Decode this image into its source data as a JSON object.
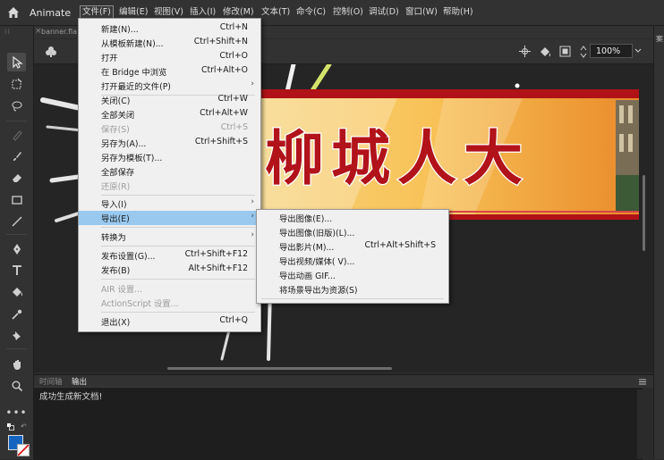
{
  "app": {
    "name": "Animate"
  },
  "menubar": [
    {
      "key": "file",
      "label": "文件(F)"
    },
    {
      "key": "edit",
      "label": "编辑(E)"
    },
    {
      "key": "view",
      "label": "视图(V)"
    },
    {
      "key": "insert",
      "label": "插入(I)"
    },
    {
      "key": "modify",
      "label": "修改(M)"
    },
    {
      "key": "text",
      "label": "文本(T)"
    },
    {
      "key": "commands",
      "label": "命令(C)"
    },
    {
      "key": "control",
      "label": "控制(O)"
    },
    {
      "key": "debug",
      "label": "调试(D)"
    },
    {
      "key": "window",
      "label": "窗口(W)"
    },
    {
      "key": "help",
      "label": "帮助(H)"
    }
  ],
  "document": {
    "tab": "banner.fla",
    "zoom": "100%"
  },
  "right_panel": {
    "label": "案"
  },
  "banner": {
    "text": "柳城人大"
  },
  "file_menu": [
    {
      "label": "新建(N)...",
      "shortcut": "Ctrl+N"
    },
    {
      "label": "从模板新建(N)...",
      "shortcut": "Ctrl+Shift+N"
    },
    {
      "label": "打开",
      "shortcut": "Ctrl+O"
    },
    {
      "label": "在 Bridge 中浏览",
      "shortcut": "Ctrl+Alt+O"
    },
    {
      "label": "打开最近的文件(P)",
      "shortcut": "",
      "submenu": true
    },
    {
      "sep": true
    },
    {
      "label": "关闭(C)",
      "shortcut": "Ctrl+W"
    },
    {
      "label": "全部关闭",
      "shortcut": "Ctrl+Alt+W"
    },
    {
      "label": "保存(S)",
      "shortcut": "Ctrl+S",
      "disabled": true
    },
    {
      "label": "另存为(A)...",
      "shortcut": "Ctrl+Shift+S"
    },
    {
      "label": "另存为模板(T)...",
      "shortcut": ""
    },
    {
      "label": "全部保存",
      "shortcut": ""
    },
    {
      "label": "还原(R)",
      "shortcut": "",
      "disabled": true
    },
    {
      "sep": true
    },
    {
      "label": "导入(I)",
      "shortcut": "",
      "submenu": true
    },
    {
      "label": "导出(E)",
      "shortcut": "",
      "submenu": true,
      "highlighted": true
    },
    {
      "sep": true
    },
    {
      "label": "转换为",
      "shortcut": "",
      "submenu": true
    },
    {
      "sep": true
    },
    {
      "label": "发布设置(G)...",
      "shortcut": "Ctrl+Shift+F12"
    },
    {
      "label": "发布(B)",
      "shortcut": "Alt+Shift+F12"
    },
    {
      "sep": true
    },
    {
      "label": "AIR 设置...",
      "shortcut": "",
      "disabled": true
    },
    {
      "label": "ActionScript 设置...",
      "shortcut": "",
      "disabled": true
    },
    {
      "sep": true
    },
    {
      "label": "退出(X)",
      "shortcut": "Ctrl+Q"
    }
  ],
  "export_submenu": [
    {
      "label": "导出图像(E)...",
      "shortcut": ""
    },
    {
      "label": "导出图像(旧版)(L)...",
      "shortcut": ""
    },
    {
      "label": "导出影片(M)...",
      "shortcut": "Ctrl+Alt+Shift+S"
    },
    {
      "label": "导出视频/媒体( V)...",
      "shortcut": ""
    },
    {
      "label": "导出动画 GIF...",
      "shortcut": ""
    },
    {
      "label": "将场景导出为资源(S)",
      "shortcut": ""
    }
  ],
  "bottom_panel": {
    "tabs": [
      {
        "label": "时间轴",
        "active": false
      },
      {
        "label": "输出",
        "active": true
      }
    ],
    "output_text": "成功生成新文档!"
  },
  "tools": [
    {
      "icon": "selection-tool-icon",
      "selected": true
    },
    {
      "icon": "free-transform-icon"
    },
    {
      "icon": "lasso-icon"
    },
    {
      "icon": "pen-disabled-icon"
    },
    {
      "icon": "brush-icon"
    },
    {
      "icon": "eraser-icon"
    },
    {
      "icon": "rectangle-icon"
    },
    {
      "icon": "line-icon"
    },
    {
      "icon": "pen-tool-icon"
    },
    {
      "icon": "text-tool-icon"
    },
    {
      "icon": "paint-bucket-icon"
    },
    {
      "icon": "eyedropper-icon"
    },
    {
      "icon": "pin-tool-icon"
    },
    {
      "icon": "hand-tool-icon"
    },
    {
      "icon": "zoom-tool-icon"
    },
    {
      "icon": "more-tools-icon"
    }
  ],
  "colors": {
    "menu_bg": "#f0f0f0",
    "menu_highlight": "#99c9ef",
    "fill_color": "#1565c0",
    "banner_red": "#b01217",
    "banner_gold": "#f3b54a"
  }
}
